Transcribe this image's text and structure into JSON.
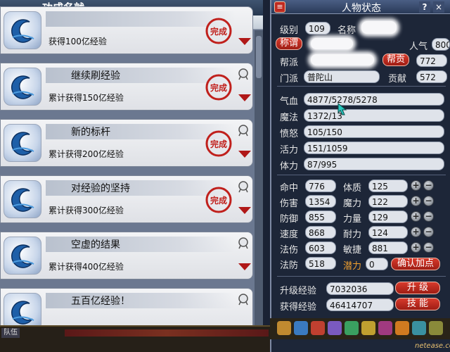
{
  "achievements_window": {
    "title": "功成名就",
    "items": [
      {
        "name": "",
        "desc": "获得100亿经验",
        "stamp": "完成"
      },
      {
        "name": "继续刷经验",
        "desc": "累计获得150亿经验",
        "stamp": "完成"
      },
      {
        "name": "新的标杆",
        "desc": "累计获得200亿经验",
        "stamp": "完成"
      },
      {
        "name": "对经验的坚持",
        "desc": "累计获得300亿经验",
        "stamp": "完成"
      },
      {
        "name": "空虚的结果",
        "desc": "累计获得400亿经验",
        "stamp": ""
      },
      {
        "name": "五百亿经验！",
        "desc": "",
        "stamp": ""
      }
    ]
  },
  "status_window": {
    "title": "人物状态",
    "menu_icon": "hamburger-icon",
    "help_label": "?",
    "close_label": "×",
    "level_label": "级别",
    "level_value": "109",
    "name_label": "名称",
    "title_button": "称谓",
    "popularity_label": "人气",
    "popularity_value": "800",
    "faction_label": "帮派",
    "faction_contrib_button": "帮贡",
    "faction_contrib_value": "772",
    "sect_label": "门派",
    "sect_value": "普陀山",
    "contrib_label": "贡献",
    "contrib_value": "572",
    "hp_label": "气血",
    "hp_value": "4877/5278/5278",
    "mp_label": "魔法",
    "mp_value": "1372/13",
    "anger_label": "愤怒",
    "anger_value": "105/150",
    "vitality_label": "活力",
    "vitality_value": "151/1059",
    "stamina_label": "体力",
    "stamina_value": "87/995",
    "stats_left": [
      {
        "label": "命中",
        "value": "776"
      },
      {
        "label": "伤害",
        "value": "1354"
      },
      {
        "label": "防御",
        "value": "855"
      },
      {
        "label": "速度",
        "value": "868"
      },
      {
        "label": "法伤",
        "value": "603"
      },
      {
        "label": "法防",
        "value": "518"
      }
    ],
    "stats_right": [
      {
        "label": "体质",
        "value": "125"
      },
      {
        "label": "魔力",
        "value": "122"
      },
      {
        "label": "力量",
        "value": "129"
      },
      {
        "label": "耐力",
        "value": "124"
      },
      {
        "label": "敏捷",
        "value": "881"
      }
    ],
    "potential_label": "潜力",
    "potential_value": "0",
    "confirm_points_button": "确认加点",
    "upgrade_exp_label": "升级经验",
    "upgrade_exp_value": "7032036",
    "upgrade_button": "升 级",
    "gained_exp_label": "获得经验",
    "gained_exp_value": "46414707",
    "skills_button": "技 能"
  },
  "taskbar": {
    "tab_label": "队伍"
  },
  "watermark": "netease.com"
}
